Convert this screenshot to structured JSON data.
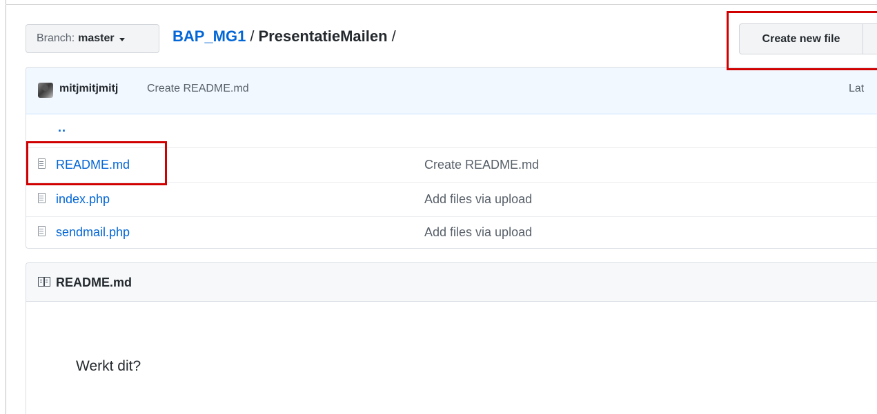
{
  "branch": {
    "prefix": "Branch:",
    "name": "master"
  },
  "breadcrumb": {
    "repo": "BAP_MG1",
    "separator": "/",
    "folder": "PresentatieMailen",
    "trailing": "/"
  },
  "toolbar": {
    "create_label": "Create new file"
  },
  "commit": {
    "author": "mitjmitjmitj",
    "message": "Create README.md",
    "latest": "Lat"
  },
  "files": [
    {
      "name": "..",
      "message": "",
      "type": "parent"
    },
    {
      "name": "README.md",
      "message": "Create README.md",
      "type": "file"
    },
    {
      "name": "index.php",
      "message": "Add files via upload",
      "type": "file"
    },
    {
      "name": "sendmail.php",
      "message": "Add files via upload",
      "type": "file"
    }
  ],
  "readme": {
    "title": "README.md",
    "content": "Werkt dit?"
  },
  "colors": {
    "link": "#0366d6",
    "highlight": "#d00000",
    "commit_bg": "#f1f8ff"
  }
}
